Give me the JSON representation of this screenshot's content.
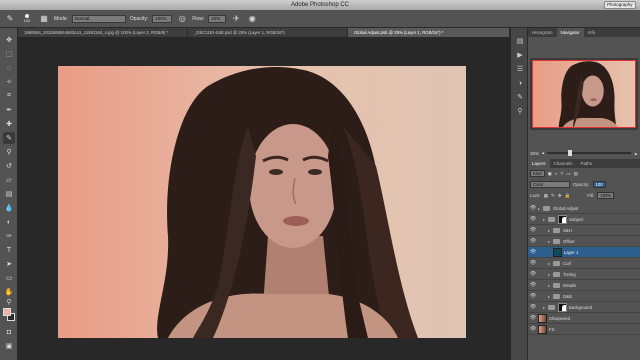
{
  "app": {
    "title": "Adobe Photoshop CC",
    "workspace": "Photography"
  },
  "options": {
    "brush_size": "100",
    "mode_label": "Mode:",
    "mode_value": "Normal",
    "opacity_label": "Opacity:",
    "opacity_value": "100%",
    "flow_label": "Flow:",
    "flow_value": "20%"
  },
  "tabs": [
    {
      "label": "1968584_1015589544683441_11591164_o.jpg @ 100% (Layer 2, RGB/8) *",
      "active": false
    },
    {
      "label": "_DSC1181-Edit.psd @ 25% (Layer 1, RGB/16*)",
      "active": false
    },
    {
      "label": "Global Adjust.psb @ 25% (Layer 1, RGB/16*) *",
      "active": true
    }
  ],
  "panels": {
    "top_tabs": [
      "Histogram",
      "Navigator",
      "Info"
    ],
    "active_top_tab": "Navigator",
    "zoom": "25%",
    "zoom_fraction": 0.25,
    "layer_tabs": [
      "Layers",
      "Channels",
      "Paths"
    ],
    "kind_label": "Kind",
    "blend_mode": "Color",
    "opacity_label": "Opacity:",
    "opacity_value": "100",
    "lock_label": "Lock:",
    "fill_label": "Fill:",
    "fill_value": "100%"
  },
  "layers": [
    {
      "name": "Global Adjust",
      "type": "folder",
      "indent": 0
    },
    {
      "name": "Subject",
      "type": "folder-mask",
      "indent": 1
    },
    {
      "name": "S&H",
      "type": "folder",
      "indent": 2
    },
    {
      "name": "Offset",
      "type": "folder",
      "indent": 2
    },
    {
      "name": "Layer 1",
      "type": "fill",
      "indent": 3,
      "selected": true,
      "color": "#0f4a5c"
    },
    {
      "name": "Curl",
      "type": "folder",
      "indent": 2
    },
    {
      "name": "Toning",
      "type": "folder",
      "indent": 2
    },
    {
      "name": "Details",
      "type": "folder",
      "indent": 2
    },
    {
      "name": "D&B",
      "type": "folder",
      "indent": 2
    },
    {
      "name": "Background",
      "type": "folder-mask",
      "indent": 1
    },
    {
      "name": "Sharpened",
      "type": "image",
      "indent": 0
    },
    {
      "name": "FS",
      "type": "image",
      "indent": 0
    }
  ],
  "colors": {
    "foreground": "#e6b7a8",
    "background": "#2a2a2a",
    "selected_layer": "#2c5e8e"
  }
}
